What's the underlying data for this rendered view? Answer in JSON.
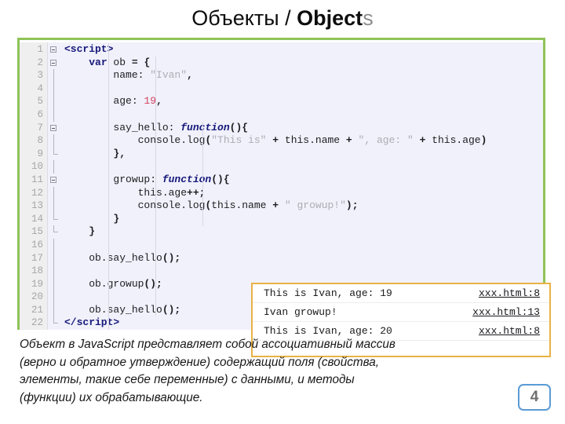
{
  "title": {
    "part_ru": "Объекты / ",
    "part_en_bold": "Object",
    "part_en_gray": "s"
  },
  "colors": {
    "panel_border_green": "#8fc359",
    "console_border_gold": "#e8b244",
    "badge_border_blue": "#5b9bd5",
    "code_bg": "#f1f1fb",
    "gutter_bg": "#efefef",
    "keyword_navy": "#16197a",
    "string_gray": "#adadb5",
    "number_pink": "#d23f5d"
  },
  "editor": {
    "line_numbers": [
      1,
      2,
      3,
      4,
      5,
      6,
      7,
      8,
      9,
      10,
      11,
      12,
      13,
      14,
      15,
      16,
      17,
      18,
      19,
      20,
      21,
      22
    ],
    "lines": [
      {
        "n": 1,
        "text": "<script>"
      },
      {
        "n": 2,
        "text": "    var ob = {"
      },
      {
        "n": 3,
        "text": "        name: \"Ivan\","
      },
      {
        "n": 4,
        "text": ""
      },
      {
        "n": 5,
        "text": "        age: 19,"
      },
      {
        "n": 6,
        "text": ""
      },
      {
        "n": 7,
        "text": "        say_hello: function(){"
      },
      {
        "n": 8,
        "text": "            console.log(\"This is\" + this.name + \", age: \" + this.age)"
      },
      {
        "n": 9,
        "text": "        },"
      },
      {
        "n": 10,
        "text": ""
      },
      {
        "n": 11,
        "text": "        growup: function(){"
      },
      {
        "n": 12,
        "text": "            this.age++;"
      },
      {
        "n": 13,
        "text": "            console.log(this.name + \" growup!\");"
      },
      {
        "n": 14,
        "text": "        }"
      },
      {
        "n": 15,
        "text": "    }"
      },
      {
        "n": 16,
        "text": ""
      },
      {
        "n": 17,
        "text": "    ob.say_hello();"
      },
      {
        "n": 18,
        "text": ""
      },
      {
        "n": 19,
        "text": "    ob.growup();"
      },
      {
        "n": 20,
        "text": ""
      },
      {
        "n": 21,
        "text": "    ob.say_hello();"
      },
      {
        "n": 22,
        "text": "</script>"
      }
    ],
    "fold_markers_at_lines": [
      1,
      2,
      7,
      11
    ],
    "fold_end_at_lines": [
      9,
      14,
      15,
      22
    ]
  },
  "console": {
    "rows": [
      {
        "message": "This is Ivan, age: 19",
        "source": "xxx.html:8"
      },
      {
        "message": "Ivan growup!",
        "source": "xxx.html:13"
      },
      {
        "message": "This is Ivan, age: 20",
        "source": "xxx.html:8"
      }
    ]
  },
  "caption": {
    "line1": "Объект в JavaScript представляет собой ассоциативный массив",
    "line2": "(верно и обратное утверждение) содержащий поля (свойства,",
    "line3": "элементы, такие себе переменные) с данными, и методы",
    "line4": "(функции) их обрабатывающие."
  },
  "page": {
    "number": "4"
  }
}
